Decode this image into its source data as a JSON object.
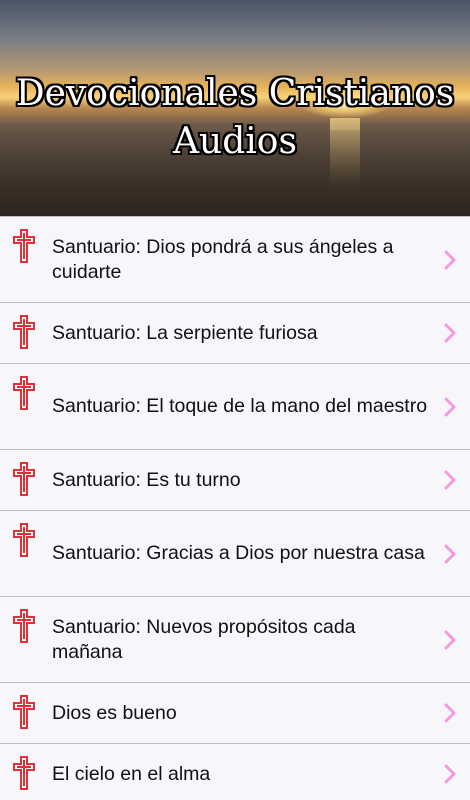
{
  "header": {
    "title_line1": "Devocionales Cristianos",
    "title_line2": "Audios"
  },
  "icons": {
    "item_icon": "cross-icon",
    "arrow_icon": "chevron-right-icon"
  },
  "colors": {
    "cross": "#e0303a",
    "chevron": "#f29ae0",
    "divider": "#bdbdbd"
  },
  "items": [
    {
      "label": "Santuario: Dios pondrá a sus ángeles a cuidarte"
    },
    {
      "label": "Santuario: La serpiente furiosa"
    },
    {
      "label": "Santuario: El toque de la mano del maestro"
    },
    {
      "label": "Santuario: Es tu turno"
    },
    {
      "label": "Santuario: Gracias a Dios por nuestra casa"
    },
    {
      "label": "Santuario: Nuevos propósitos cada mañana"
    },
    {
      "label": "Dios es bueno"
    },
    {
      "label": "El cielo en el alma"
    }
  ]
}
